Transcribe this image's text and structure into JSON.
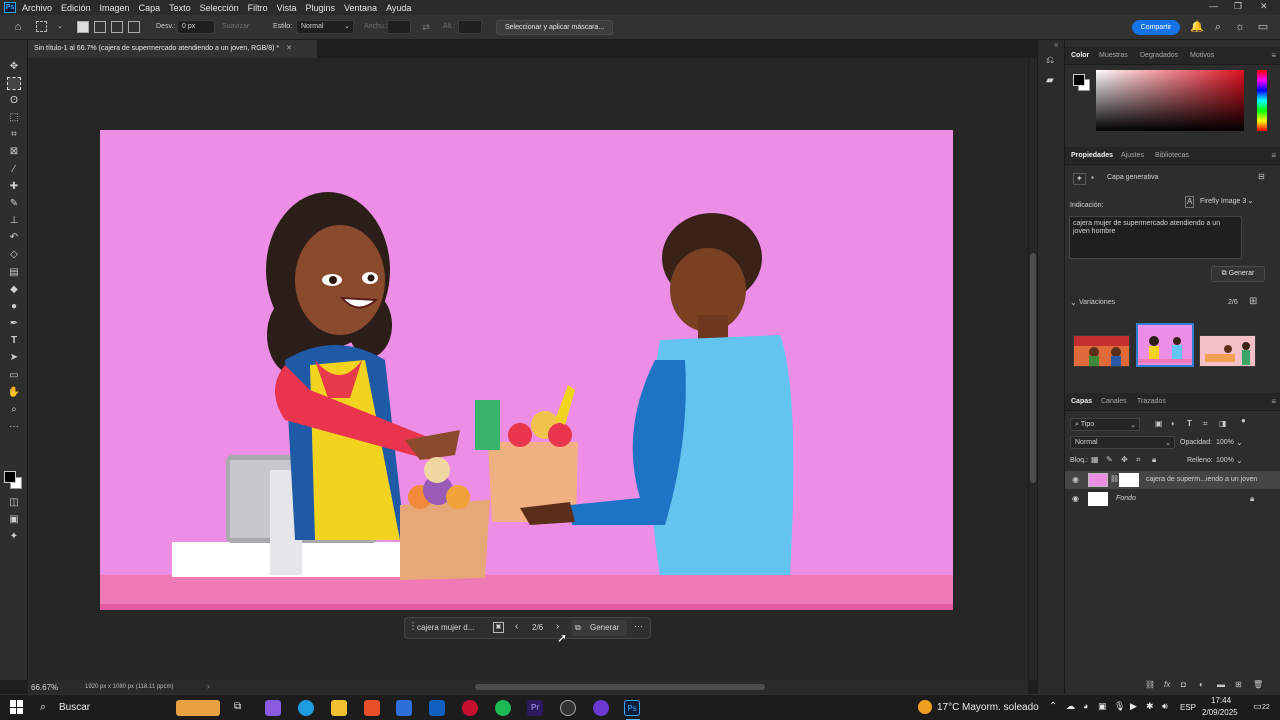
{
  "app": {
    "logo": "Ps"
  },
  "menu": [
    "Archivo",
    "Edición",
    "Imagen",
    "Capa",
    "Texto",
    "Selección",
    "Filtro",
    "Vista",
    "Plugins",
    "Ventana",
    "Ayuda"
  ],
  "options": {
    "feather_label": "Desv.:",
    "feather_value": "0 px",
    "smooth_label": "Suavizar",
    "style_label": "Estilo:",
    "style_value": "Normal",
    "width_label": "Anchu.:",
    "height_label": "Alt.:",
    "mask_button": "Seleccionar y aplicar máscara...",
    "share_button": "Compartir"
  },
  "document": {
    "tab_title": "Sin título-1 al 66.7% (cajera de supermercado atendiendo a un joven, RGB/8) *",
    "zoom": "66.67%",
    "dimensions": "1920 px x 1080 px (118.11 ppcm)"
  },
  "context_bar": {
    "prompt_preview": "cajera mujer d...",
    "counter": "2/6",
    "generate": "Generar",
    "more": "···"
  },
  "color_panel": {
    "tabs": [
      "Color",
      "Muestras",
      "Degradados",
      "Motivos"
    ],
    "active": "Color"
  },
  "properties_panel": {
    "tabs": [
      "Propiedades",
      "Ajustes",
      "Bibliotecas"
    ],
    "layer_type": "Capa generativa",
    "model": "Firefly Image 3",
    "prompt_label": "Indicación:",
    "prompt_text": "cajera mujer de supermercado atendiendo a un joven hombre",
    "generate_button": "Generar",
    "variations_label": "Variaciones",
    "variations_count": "2/6"
  },
  "layers_panel": {
    "tabs": [
      "Capas",
      "Canales",
      "Trazados"
    ],
    "filter": "Tipo",
    "blend_mode": "Normal",
    "opacity_label": "Opacidad:",
    "opacity": "100%",
    "lock_label": "Bloq.:",
    "fill_label": "Relleno:",
    "fill": "100%",
    "layers": [
      {
        "name": "cajera de superm...iendo a un joven",
        "italic": false
      },
      {
        "name": "Fondo",
        "italic": true
      }
    ]
  },
  "taskbar": {
    "search": "Buscar",
    "weather_temp": "17°C",
    "weather_desc": "Mayorm. soleado",
    "language": "ESP",
    "time": "17:44",
    "date": "2/09/2025",
    "notifications": "22"
  },
  "colors": {
    "canvas_bg": "#ec8ee6",
    "accent": "#1473e6",
    "panel_bg": "#2d2d2d"
  }
}
